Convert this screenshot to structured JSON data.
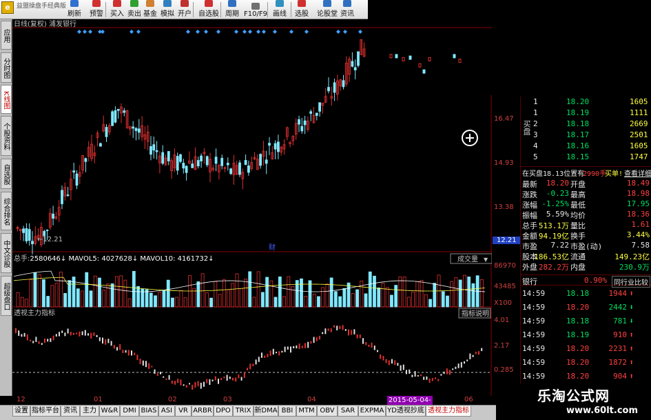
{
  "toolbar": {
    "app_title": "益盟操盘手经典版",
    "buttons": [
      {
        "label": "刷新",
        "icon": "refresh-icon",
        "color": "#3070d0"
      },
      {
        "label": "预警",
        "icon": "alert-icon",
        "color": "#d03030"
      },
      {
        "label": "买入",
        "icon": "buy-icon",
        "color": "#d03030"
      },
      {
        "label": "卖出",
        "icon": "sell-icon",
        "color": "#30a030"
      },
      {
        "label": "基金",
        "icon": "fund-icon",
        "color": "#d08030"
      },
      {
        "label": "模拟",
        "icon": "simulate-icon",
        "color": "#3080c0"
      },
      {
        "label": "开户",
        "icon": "account-icon",
        "color": "#c03030"
      },
      {
        "label": "自选股",
        "icon": "watchlist-icon",
        "color": "#d03030"
      },
      {
        "label": "周期",
        "icon": "period-icon",
        "color": "#3070c0"
      },
      {
        "label": "F10/F9",
        "icon": "f10-icon",
        "color": "#707070"
      },
      {
        "label": "画线",
        "icon": "draw-line-icon",
        "color": "#3090c0"
      },
      {
        "label": "选股",
        "icon": "stock-pick-icon",
        "color": "#d03030"
      },
      {
        "label": "论股堂",
        "icon": "forum-icon",
        "color": "#3070c0"
      },
      {
        "label": "资讯",
        "icon": "news-icon",
        "color": "#3070c0"
      }
    ]
  },
  "left_tabs": [
    {
      "label": "应用",
      "active": false
    },
    {
      "label": "分时图",
      "active": false
    },
    {
      "label": "K线图",
      "active": true
    },
    {
      "label": "个股资料",
      "active": false
    },
    {
      "label": "自选股",
      "active": false
    },
    {
      "label": "综合排名",
      "active": false
    },
    {
      "label": "中文诊股",
      "active": false
    },
    {
      "label": "超级盘口",
      "active": false
    }
  ],
  "kline": {
    "header": "日线(复权) 浦发银行",
    "price_labels": [
      "16.47",
      "14.93",
      "13.38",
      "12.21"
    ],
    "low_marker": "12.21",
    "fin_marker": "财",
    "price_min": 11.9,
    "price_max": 18.3
  },
  "volume": {
    "header_total_label": "总手:",
    "header_total": "2580646",
    "mavol5_label": "MAVOL5:",
    "mavol5": "4027628",
    "mavol10_label": "MAVOL10:",
    "mavol10": "4161732",
    "dropdown": "成交量",
    "axis_labels": [
      "86970",
      "43485",
      "X100"
    ]
  },
  "indicator": {
    "title": "透视主力指标",
    "button": "指标说明",
    "axis_labels": [
      "4.01",
      "2.17",
      "0.285"
    ],
    "ref_level": 0.285
  },
  "x_axis": {
    "labels": [
      "12",
      "01",
      "02",
      "03",
      "04",
      "06"
    ],
    "cursor_date": "2015-05-04-"
  },
  "bottom_tabs": [
    {
      "label": "设置",
      "active": false
    },
    {
      "label": "指标平台",
      "active": false
    },
    {
      "label": "资讯",
      "active": false
    },
    {
      "label": "主力",
      "active": false
    },
    {
      "label": "W&R",
      "active": false
    },
    {
      "label": "DMI",
      "active": false
    },
    {
      "label": "BIAS",
      "active": false
    },
    {
      "label": "ASI",
      "active": false
    },
    {
      "label": "VR",
      "active": false
    },
    {
      "label": "ARBR",
      "active": false
    },
    {
      "label": "DPO",
      "active": false
    },
    {
      "label": "TRIX",
      "active": false
    },
    {
      "label": "新DMA",
      "active": false
    },
    {
      "label": "BBI",
      "active": false
    },
    {
      "label": "MTM",
      "active": false
    },
    {
      "label": "OBV",
      "active": false
    },
    {
      "label": "SAR",
      "active": false
    },
    {
      "label": "EXPMA",
      "active": false
    },
    {
      "label": "YD透视抄底",
      "active": false
    },
    {
      "label": "透视主力指标",
      "active": true
    }
  ],
  "quote": {
    "bid_label": "买盘",
    "bids": [
      {
        "level": "1",
        "price": "18.20",
        "volume": "1605"
      },
      {
        "level": "1",
        "price": "18.19",
        "volume": "1111"
      },
      {
        "level": "2",
        "price": "18.18",
        "volume": "2669"
      },
      {
        "level": "3",
        "price": "18.17",
        "volume": "2501"
      },
      {
        "level": "4",
        "price": "18.16",
        "volume": "1605"
      },
      {
        "level": "5",
        "price": "18.15",
        "volume": "1747"
      }
    ],
    "buy_notice": {
      "text": "在买盘18.13位置有",
      "qty": "2990手",
      "action": "买单!",
      "link": "查看详细"
    },
    "stats": [
      {
        "l1": "最新",
        "v1": "18.20",
        "c1": "red",
        "l2": "开盘",
        "v2": "18.49",
        "c2": "red"
      },
      {
        "l1": "涨跌",
        "v1": "-0.23",
        "c1": "grn",
        "l2": "最高",
        "v2": "18.98",
        "c2": "red"
      },
      {
        "l1": "涨幅",
        "v1": "-1.25%",
        "c1": "grn",
        "l2": "最低",
        "v2": "17.95",
        "c2": "grn"
      },
      {
        "l1": "振幅",
        "v1": "5.59%",
        "c1": "wht",
        "l2": "均价",
        "v2": "18.36",
        "c2": "red"
      },
      {
        "l1": "总手",
        "v1": "513.1万",
        "c1": "yel",
        "l2": "量比",
        "v2": "1.61",
        "c2": "red"
      },
      {
        "l1": "金额",
        "v1": "94.19亿",
        "c1": "yel",
        "l2": "换手",
        "v2": "3.44%",
        "c2": "yel"
      },
      {
        "l1": "市盈",
        "v1": "7.22",
        "c1": "wht",
        "l2": "市盈(动)",
        "v2": "7.58",
        "c2": "wht"
      },
      {
        "l1": "股本",
        "v1": "186.53亿",
        "c1": "yel",
        "l2": "流通",
        "v2": "149.23亿",
        "c2": "yel"
      },
      {
        "l1": "外盘",
        "v1": "282.2万",
        "c1": "red",
        "l2": "内盘",
        "v2": "230.9万",
        "c2": "grn"
      }
    ],
    "industry": {
      "name": "银行",
      "change": "0.90%",
      "link": "同行业比较"
    },
    "ticks": [
      {
        "time": "14:59",
        "price": "18.18",
        "vol": "1944",
        "dir": "up",
        "pc": "grn"
      },
      {
        "time": "14:59",
        "price": "18.20",
        "vol": "2442",
        "dir": "down",
        "pc": "red"
      },
      {
        "time": "14:59",
        "price": "18.18",
        "vol": "781",
        "dir": "down",
        "pc": "grn"
      },
      {
        "time": "14:59",
        "price": "18.19",
        "vol": "910",
        "dir": "up",
        "pc": "grn"
      },
      {
        "time": "14:59",
        "price": "18.20",
        "vol": "2231",
        "dir": "up",
        "pc": "red"
      },
      {
        "time": "14:59",
        "price": "18.20",
        "vol": "1872",
        "dir": "up",
        "pc": "red"
      },
      {
        "time": "14:59",
        "price": "18.20",
        "vol": "904",
        "dir": "up",
        "pc": "red"
      }
    ]
  },
  "watermark": {
    "title": "乐淘公式网",
    "url": "www.60lt.com"
  },
  "colors": {
    "up": "#e03030",
    "down": "#80e8ff",
    "dash": "#ffffff"
  }
}
